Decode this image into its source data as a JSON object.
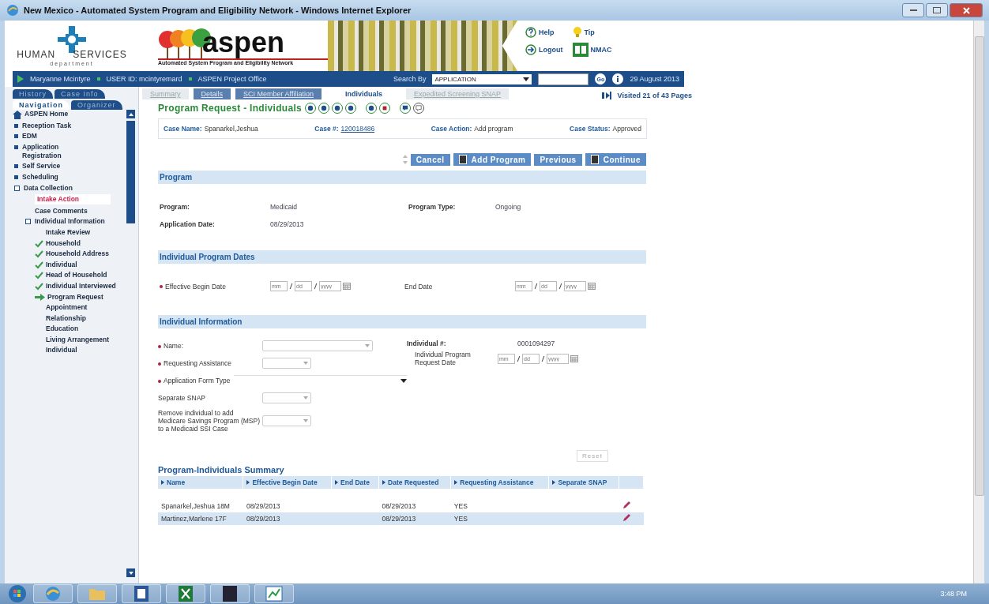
{
  "window": {
    "title": "New Mexico - Automated System Program and Eligibility Network - Windows Internet Explorer"
  },
  "header": {
    "agency_top": "HUMAN",
    "agency_right": "SERVICES",
    "agency_sub": "department",
    "brand": "aspen",
    "tagline": "Automated System Program and Eligibility Network",
    "links": [
      {
        "kind": "help",
        "label": "Help"
      },
      {
        "kind": "tip",
        "label": "Tip"
      },
      {
        "kind": "logout",
        "label": "Logout"
      },
      {
        "kind": "book",
        "label": "NMAC"
      }
    ]
  },
  "user_bar": {
    "user": "Maryanne Mcintyre",
    "user_id": "USER ID: mcintyremard",
    "office": "ASPEN Project Office",
    "search_label": "Search By",
    "search_by": "APPLICATION",
    "go": "Go",
    "date": "29 August 2013"
  },
  "side_tabs": [
    {
      "label": "History",
      "selected": false
    },
    {
      "label": "Case Info",
      "selected": false
    },
    {
      "label": "Navigation",
      "selected": true
    },
    {
      "label": "Organizer",
      "selected": false
    }
  ],
  "nav": {
    "items": [
      {
        "label": "ASPEN Home",
        "kind": "home"
      },
      {
        "label": "Reception Task",
        "kind": "square"
      },
      {
        "label": "EDM",
        "kind": "square"
      },
      {
        "label": "Application Registration",
        "kind": "square"
      },
      {
        "label": "Self Service",
        "kind": "square"
      },
      {
        "label": "Scheduling",
        "kind": "square"
      },
      {
        "label": "Data Collection",
        "kind": "toggle",
        "expanded": true,
        "children": [
          {
            "label": "Intake Action",
            "kind": "plain",
            "selected": true
          },
          {
            "label": "Case Comments",
            "kind": "plain",
            "selected": false
          },
          {
            "label": "Individual Information",
            "kind": "toggle",
            "expanded": true,
            "children": [
              {
                "label": "Intake Review",
                "kind": "plain"
              },
              {
                "label": "Household",
                "kind": "check"
              },
              {
                "label": "Household Address",
                "kind": "check"
              },
              {
                "label": "Individual",
                "kind": "check"
              },
              {
                "label": "Head of Household",
                "kind": "check"
              },
              {
                "label": "Individual Interviewed",
                "kind": "check"
              },
              {
                "label": "Program Request",
                "kind": "arrow"
              },
              {
                "label": "Appointment",
                "kind": "plain"
              },
              {
                "label": "Relationship",
                "kind": "plain"
              },
              {
                "label": "Education",
                "kind": "plain"
              },
              {
                "label": "Living Arrangement",
                "kind": "plain"
              },
              {
                "label": "Individual",
                "kind": "plain"
              }
            ]
          }
        ]
      }
    ]
  },
  "page_tabs": [
    {
      "label": "Summary",
      "selected": false,
      "disabled": true
    },
    {
      "label": "Details",
      "selected": false,
      "disabled": false
    },
    {
      "label": "SCI Member Affiliation",
      "selected": false,
      "disabled": false
    },
    {
      "label": "Individuals",
      "selected": true,
      "disabled": false
    },
    {
      "label": "Expedited Screening SNAP",
      "selected": false,
      "disabled": true
    }
  ],
  "visited": "Visited 21 of 43 Pages",
  "page_title": "Program Request - Individuals",
  "case": [
    {
      "label": "Case Name:",
      "value": "Spanarkel,Jeshua",
      "link": false
    },
    {
      "label": "Case #:",
      "value": "120018486",
      "link": true
    },
    {
      "label": "Case Action:",
      "value": "Add program",
      "link": false
    },
    {
      "label": "Case Status:",
      "value": "Approved",
      "link": false
    }
  ],
  "buttons": [
    {
      "label": "Cancel",
      "icon": false
    },
    {
      "label": "Add Program",
      "icon": true
    },
    {
      "label": "Previous",
      "icon": false
    },
    {
      "label": "Continue",
      "icon": true
    }
  ],
  "program": {
    "heading": "Program",
    "fields": [
      {
        "label": "Program:",
        "value": "Medicaid"
      },
      {
        "label": "Program Type:",
        "value": "Ongoing"
      },
      {
        "label": "Application Date:",
        "value": "08/29/2013"
      }
    ]
  },
  "dates": {
    "heading": "Individual Program Dates",
    "fields": [
      {
        "label": "Effective Begin Date",
        "required": true,
        "placeholders": [
          "mm",
          "dd",
          "yyyy"
        ]
      },
      {
        "label": "End Date",
        "required": false,
        "placeholders": [
          "mm",
          "dd",
          "yyyy"
        ]
      }
    ]
  },
  "individual": {
    "heading": "Individual Information",
    "left": [
      {
        "label": "Name:",
        "required": true,
        "kind": "wide-select"
      },
      {
        "label": "Requesting Assistance",
        "required": true,
        "kind": "select"
      },
      {
        "label": "Application Form Type",
        "required": true,
        "kind": "line"
      },
      {
        "label": "Separate SNAP",
        "required": false,
        "kind": "select"
      },
      {
        "label": "Remove individual to add Medicare Savings Program (MSP) to a Medicaid SSI Case",
        "required": false,
        "kind": "select"
      }
    ],
    "number_label": "Individual #:",
    "number": "0001094297",
    "request_date_label": "Individual Program Request Date",
    "request_date_placeholders": [
      "mm",
      "dd",
      "yyyy"
    ]
  },
  "reset": "Reset",
  "summary": {
    "title": "Program-Individuals Summary",
    "columns": [
      "Name",
      "Effective Begin Date",
      "End Date",
      "Date Requested",
      "Requesting Assistance",
      "Separate SNAP"
    ],
    "rows": [
      [
        "Spanarkel,Jeshua 18M",
        "08/29/2013",
        "",
        "08/29/2013",
        "YES",
        ""
      ],
      [
        "Martinez,Marlene 17F",
        "08/29/2013",
        "",
        "08/29/2013",
        "YES",
        ""
      ]
    ]
  },
  "clock": "3:48 PM"
}
